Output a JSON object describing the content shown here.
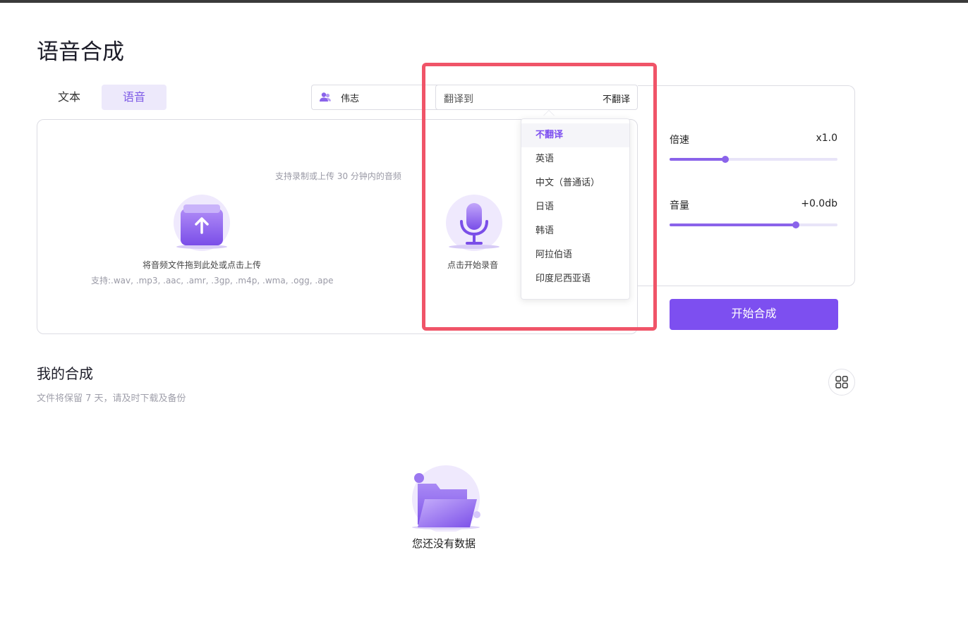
{
  "page": {
    "title": "语音合成"
  },
  "tabs": [
    {
      "label": "文本",
      "active": false
    },
    {
      "label": "语音",
      "active": true
    }
  ],
  "voice": {
    "icon": "user-group-icon",
    "name": "伟志"
  },
  "translate": {
    "label": "翻译到",
    "value": "不翻译",
    "options": [
      "不翻译",
      "英语",
      "中文（普通话）",
      "日语",
      "韩语",
      "阿拉伯语",
      "印度尼西亚语"
    ],
    "selected_index": 0
  },
  "upload": {
    "hint": "支持录制或上传 30 分钟内的音频",
    "drop_label": "将音频文件拖到此处或点击上传",
    "formats": "支持:.wav, .mp3, .aac, .amr, .3gp, .m4p, .wma, .ogg, .ape",
    "record_label": "点击开始录音"
  },
  "settings": {
    "speed": {
      "label": "倍速",
      "value": "x1.0",
      "level": 0.33
    },
    "volume": {
      "label": "音量",
      "value": "+0.0db",
      "level": 0.75
    }
  },
  "actions": {
    "start_label": "开始合成"
  },
  "my_synthesis": {
    "title": "我的合成",
    "subtitle": "文件将保留 7 天，请及时下载及备份",
    "empty_text": "您还没有数据"
  },
  "colors": {
    "accent": "#7d4ff0",
    "highlight": "#f05468",
    "tab_bg": "#ede9fb"
  }
}
